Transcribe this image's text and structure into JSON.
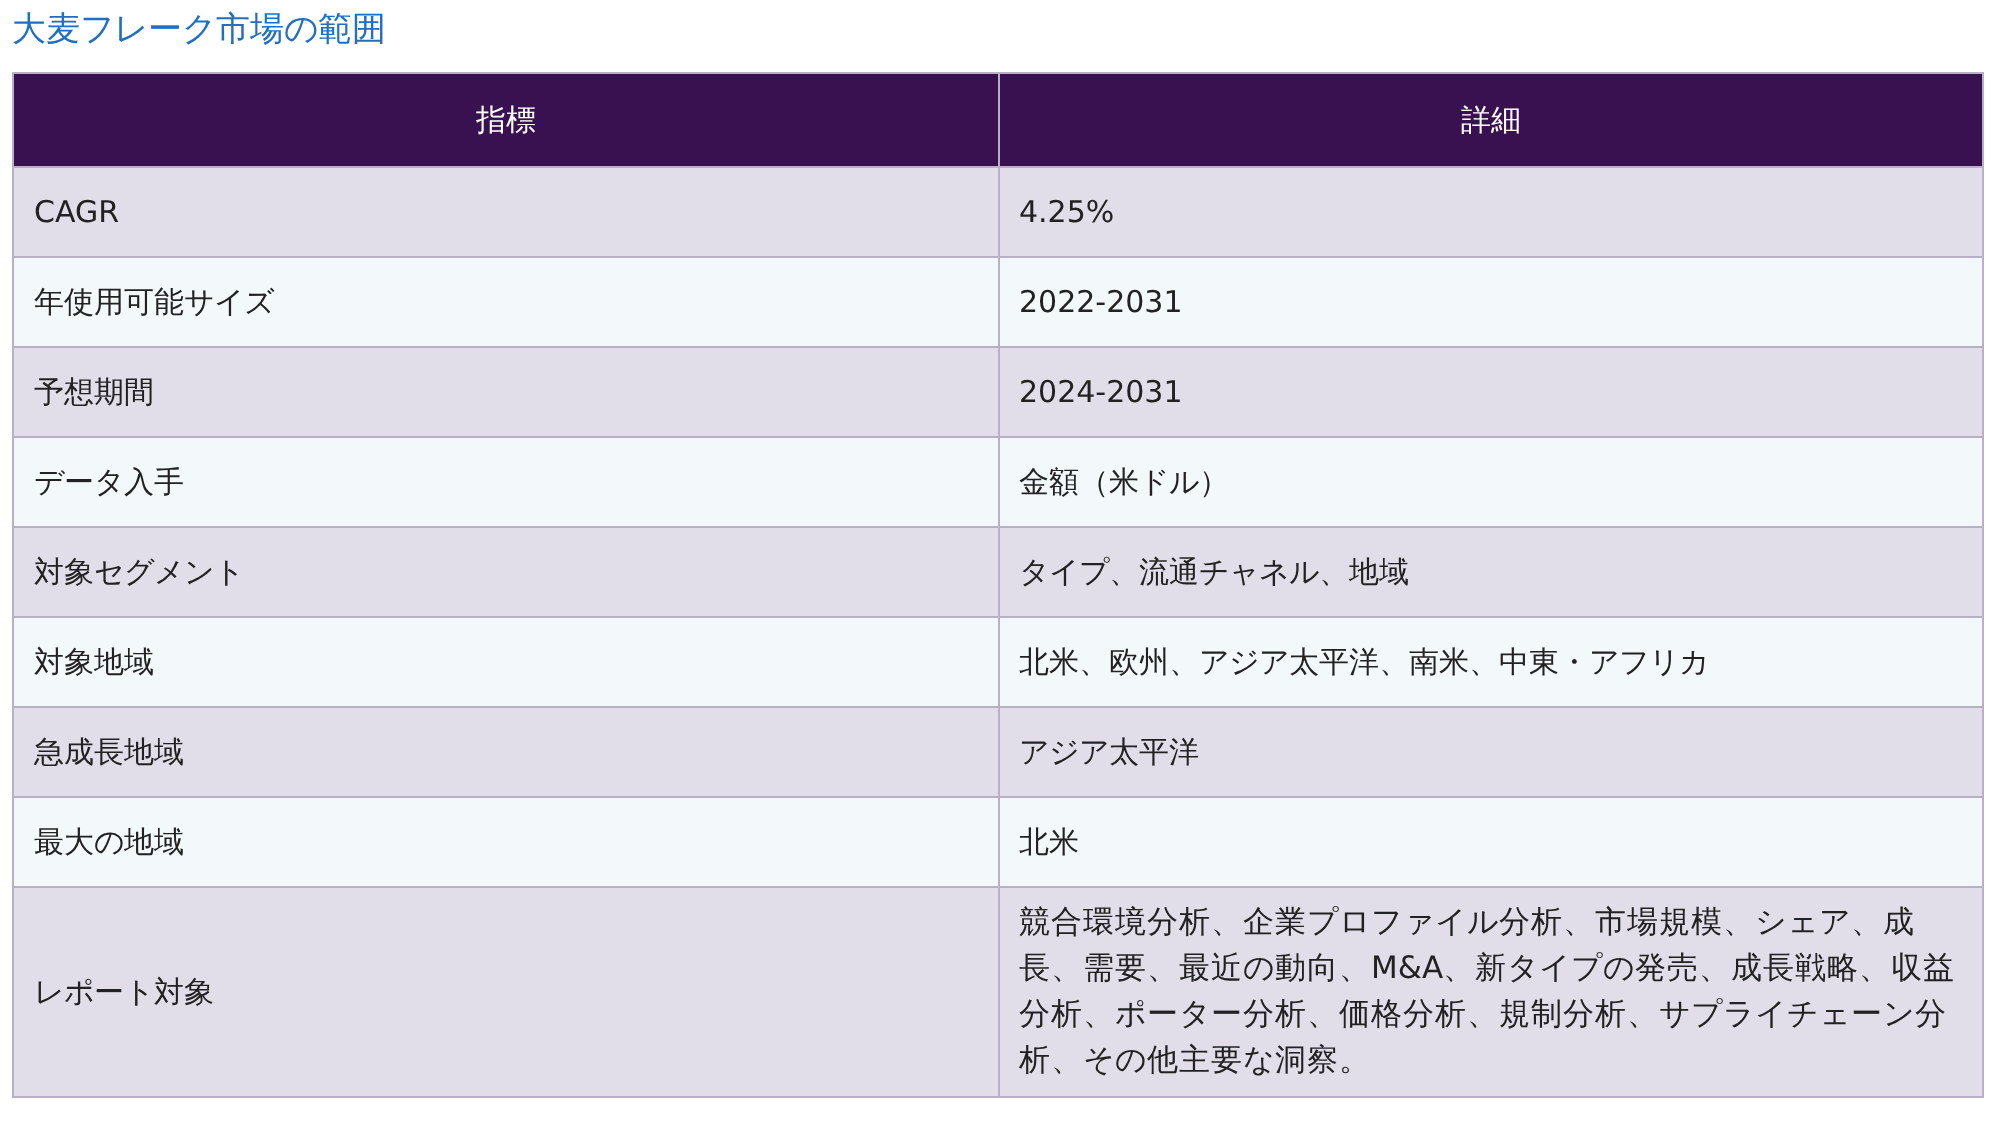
{
  "title": "大麦フレーク市場の範囲",
  "table": {
    "columns": [
      "指標",
      "詳細"
    ],
    "rows": [
      [
        "CAGR",
        "4.25%"
      ],
      [
        "年使用可能サイズ",
        "2022-2031"
      ],
      [
        "予想期間",
        "2024-2031"
      ],
      [
        "データ入手",
        "金額（米ドル）"
      ],
      [
        "対象セグメント",
        "タイプ、流通チャネル、地域"
      ],
      [
        "対象地域",
        "北米、欧州、アジア太平洋、南米、中東・アフリカ"
      ],
      [
        "急成長地域",
        "アジア太平洋"
      ],
      [
        "最大の地域",
        "北米"
      ],
      [
        "レポート対象",
        "競合環境分析、企業プロファイル分析、市場規模、シェア、成長、需要、最近の動向、M&A、新タイプの発売、成長戦略、収益分析、ポーター分析、価格分析、規制分析、サプライチェーン分析、その他主要な洞察。"
      ]
    ]
  }
}
